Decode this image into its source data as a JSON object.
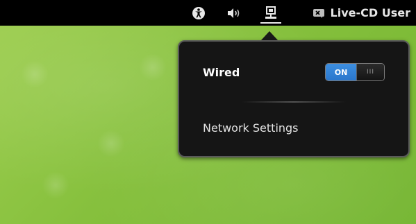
{
  "topbar": {
    "icons": [
      {
        "name": "accessibility-icon"
      },
      {
        "name": "volume-icon"
      },
      {
        "name": "network-wired-icon"
      }
    ],
    "user": {
      "icon": "user-status-icon",
      "label": "Live-CD User"
    }
  },
  "network_menu": {
    "wired_label": "Wired",
    "switch": {
      "on_label": "ON",
      "knob_label": "III",
      "state": "on",
      "accent": "#3d8fe0"
    },
    "settings_label": "Network Settings"
  },
  "colors": {
    "desktop_green": "#86c03d",
    "panel_bg": "#000000",
    "popup_bg": "#151515",
    "popup_border": "#5a5a5a"
  }
}
